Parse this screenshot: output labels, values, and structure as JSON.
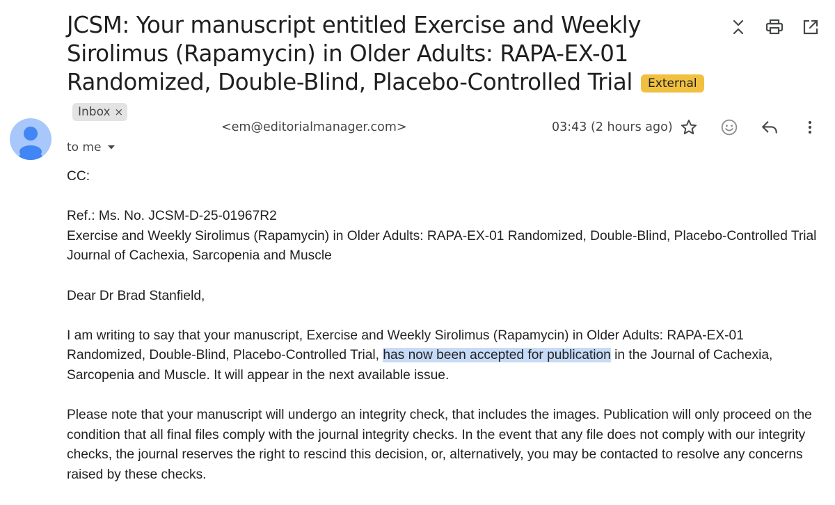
{
  "email": {
    "subject": "JCSM: Your manuscript entitled Exercise and Weekly Sirolimus (Rapamycin) in Older Adults: RAPA-EX-01 Randomized, Double-Blind, Placebo-Controlled Trial",
    "labels": {
      "external": "External",
      "inbox": "Inbox",
      "inbox_remove": "×"
    },
    "toolbar": {
      "icons": [
        "expand-collapse-icon",
        "print-icon",
        "open-in-new-window-icon"
      ]
    },
    "sender_email": "<em@editorialmanager.com>",
    "timestamp": "03:43 (2 hours ago)",
    "recipient": "to me",
    "message_actions": [
      "star-icon",
      "emoji-reaction-icon",
      "reply-icon",
      "more-options-icon"
    ],
    "body": {
      "cc": "CC:",
      "ref_line": "Ref.:  Ms. No. JCSM-D-25-01967R2",
      "title_line": "Exercise and Weekly Sirolimus (Rapamycin) in Older Adults: RAPA-EX-01 Randomized, Double-Blind, Placebo-Controlled Trial",
      "journal_line": "Journal of Cachexia, Sarcopenia and Muscle",
      "greeting": "Dear Dr Brad Stanfield,",
      "para1_before": "I am writing to say that your manuscript, Exercise and Weekly Sirolimus (Rapamycin) in Older Adults: RAPA-EX-01 Randomized, Double-Blind, Placebo-Controlled Trial, ",
      "para1_highlight": "has now been accepted for publication",
      "para1_after": " in the Journal of Cachexia, Sarcopenia and Muscle. It will appear in the next available issue.",
      "para2": "Please note that your manuscript will undergo an integrity check, that includes the images. Publication will only proceed on the condition that all final files comply with the journal integrity checks. In the event that any file does not comply with our integrity checks, the journal reserves the right to rescind this decision, or, alternatively, you may be contacted to resolve any concerns raised by these checks."
    }
  },
  "colors": {
    "external_label": "#f1c040",
    "inbox_label": "#e3e3e3",
    "highlight": "#c6dbf7",
    "avatar": "#a8c7fa",
    "avatar_figure": "#4285f4"
  }
}
